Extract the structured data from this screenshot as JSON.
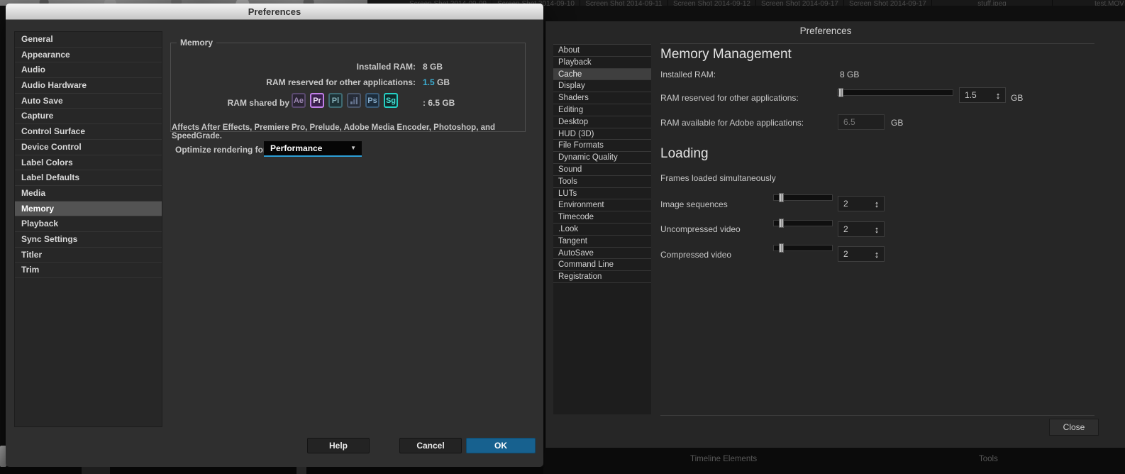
{
  "background": {
    "tabs": [
      "Screen Shot 2014-09-09",
      "Screen Shot 2014-09-10",
      "Screen Shot 2014-09-11",
      "Screen Shot 2014-09-12",
      "Screen Shot 2014-09-17",
      "Screen Shot 2014-09-17",
      "stuff.jpeg",
      "test.MOV"
    ],
    "panel_labels": {
      "timeline": "Timeline Elements",
      "tools": "Tools"
    }
  },
  "icons": {
    "stepper": "↕",
    "dropdown_caret": "▼"
  },
  "colors": {
    "accent_cyan": "#3BAFD4",
    "ok_button_blue": "#17618F",
    "left_selected_row": "#535353",
    "right_selected_row": "#3F3F3F"
  },
  "left_dialog": {
    "title": "Preferences",
    "sidebar_items": [
      "General",
      "Appearance",
      "Audio",
      "Audio Hardware",
      "Auto Save",
      "Capture",
      "Control Surface",
      "Device Control",
      "Label Colors",
      "Label Defaults",
      "Media",
      "Memory",
      "Playback",
      "Sync Settings",
      "Titler",
      "Trim"
    ],
    "selected_index": 11,
    "memory_group": {
      "legend": "Memory",
      "installed_label": "Installed RAM:",
      "installed_value": "8 GB",
      "reserved_label": "RAM reserved for other applications:",
      "reserved_value": "1.5",
      "reserved_unit": "GB",
      "shared_label": "RAM shared by",
      "shared_value": ":  6.5 GB",
      "badges": [
        {
          "label": "Ae"
        },
        {
          "label": "Pr"
        },
        {
          "label": "Pl"
        },
        {
          "label": "",
          "icon": "media-encoder-checker"
        },
        {
          "label": "Ps"
        },
        {
          "label": "Sg"
        }
      ],
      "note": "Affects After Effects, Premiere Pro, Prelude, Adobe Media Encoder, Photoshop, and SpeedGrade."
    },
    "optimize_label": "Optimize rendering for:",
    "optimize_value": "Performance",
    "buttons": {
      "help": "Help",
      "cancel": "Cancel",
      "ok": "OK"
    }
  },
  "right_dialog": {
    "title": "Preferences",
    "category_items": [
      "About",
      "Playback",
      "Cache",
      "Display",
      "Shaders",
      "Editing",
      "Desktop",
      "HUD (3D)",
      "File Formats",
      "Dynamic Quality",
      "Sound",
      "Tools",
      "LUTs",
      "Environment",
      "Timecode",
      ".Look",
      "Tangent",
      "AutoSave",
      "Command Line",
      "Registration"
    ],
    "selected_index": 2,
    "memory_management": {
      "heading": "Memory Management",
      "installed_label": "Installed RAM:",
      "installed_value": "8 GB",
      "reserved_label": "RAM reserved for other applications:",
      "reserved_value": "1.5",
      "reserved_unit": "GB",
      "available_label": "RAM available for Adobe applications:",
      "available_value": "6.5",
      "available_unit": "GB"
    },
    "loading": {
      "heading": "Loading",
      "frames_label": "Frames loaded simultaneously",
      "rows": [
        {
          "label": "Image sequences",
          "value": "2"
        },
        {
          "label": "Uncompressed video",
          "value": "2"
        },
        {
          "label": "Compressed video",
          "value": "2"
        }
      ]
    },
    "close_label": "Close"
  }
}
